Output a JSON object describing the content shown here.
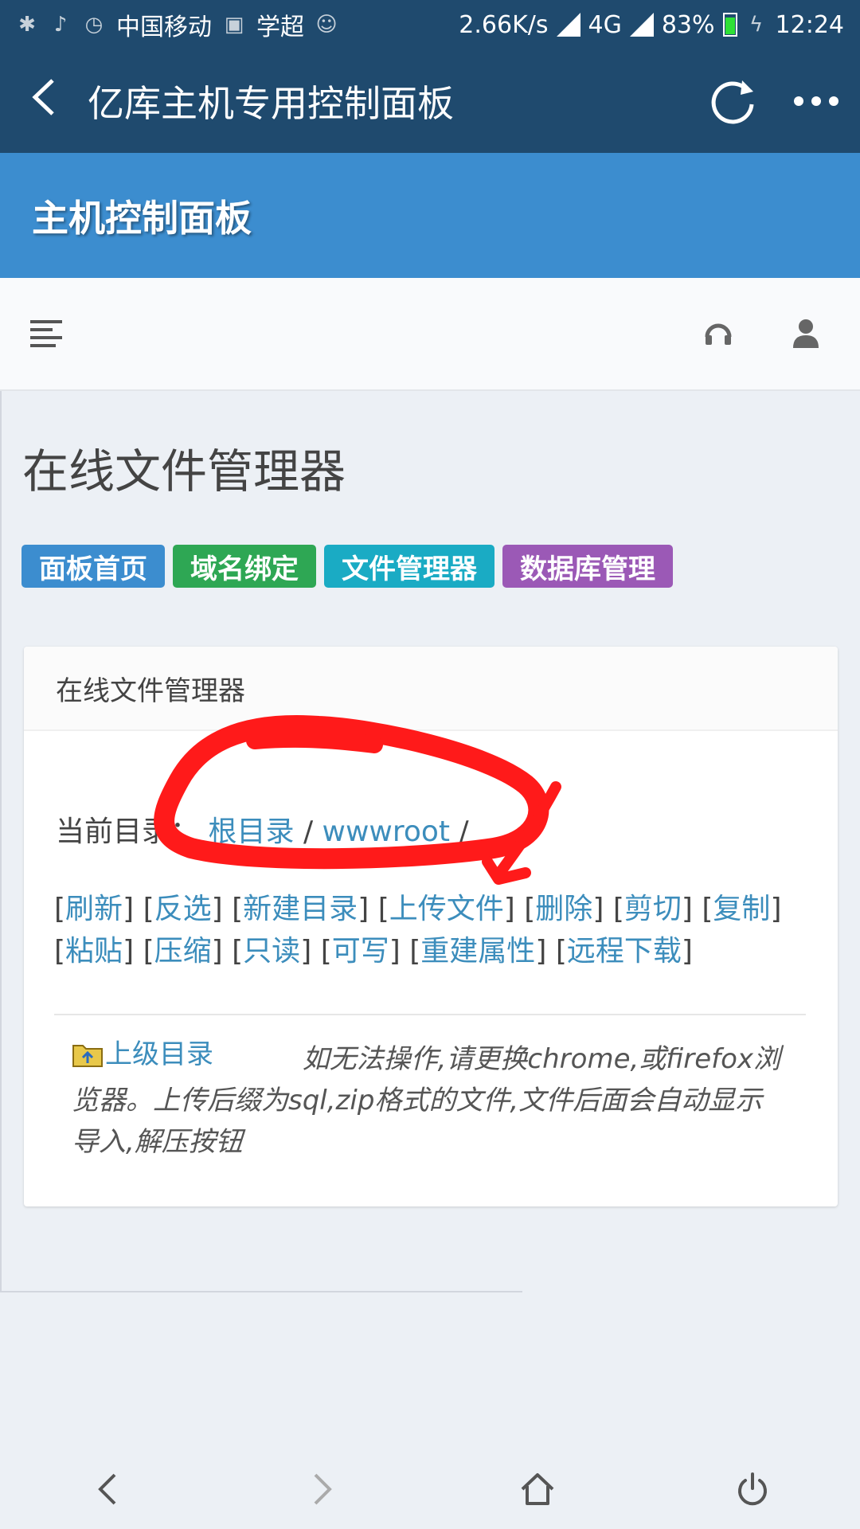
{
  "status_bar": {
    "carrier": "中国移动",
    "app_notice": "学超",
    "speed": "2.66K/s",
    "network": "4G",
    "battery": "83%",
    "time": "12:24"
  },
  "title_bar": {
    "title": "亿库主机专用控制面板"
  },
  "header": {
    "title": "主机控制面板"
  },
  "page": {
    "title": "在线文件管理器"
  },
  "tags": [
    {
      "label": "面板首页",
      "color": "#3c8dcf"
    },
    {
      "label": "域名绑定",
      "color": "#2ea754"
    },
    {
      "label": "文件管理器",
      "color": "#1aabc4"
    },
    {
      "label": "数据库管理",
      "color": "#9b59b6"
    }
  ],
  "box": {
    "title": "在线文件管理器",
    "current_dir_label": "当前目录：",
    "path": [
      "根目录",
      "wwwroot"
    ],
    "path_sep": "/",
    "actions": [
      "刷新",
      "反选",
      "新建目录",
      "上传文件",
      "删除",
      "剪切",
      "复制",
      "粘贴",
      "压缩",
      "只读",
      "可写",
      "重建属性",
      "远程下载"
    ],
    "up_link": "上级目录",
    "hint": "如无法操作,请更换chrome,或firefox浏览器。上传后缀为sql,zip格式的文件,文件后面会自动显示导入,解压按钮"
  },
  "colors": {
    "status_bg": "#1f4a6e",
    "header_bg": "#3c8dcf",
    "link": "#3c8dbc",
    "annotation": "#ff0000"
  }
}
